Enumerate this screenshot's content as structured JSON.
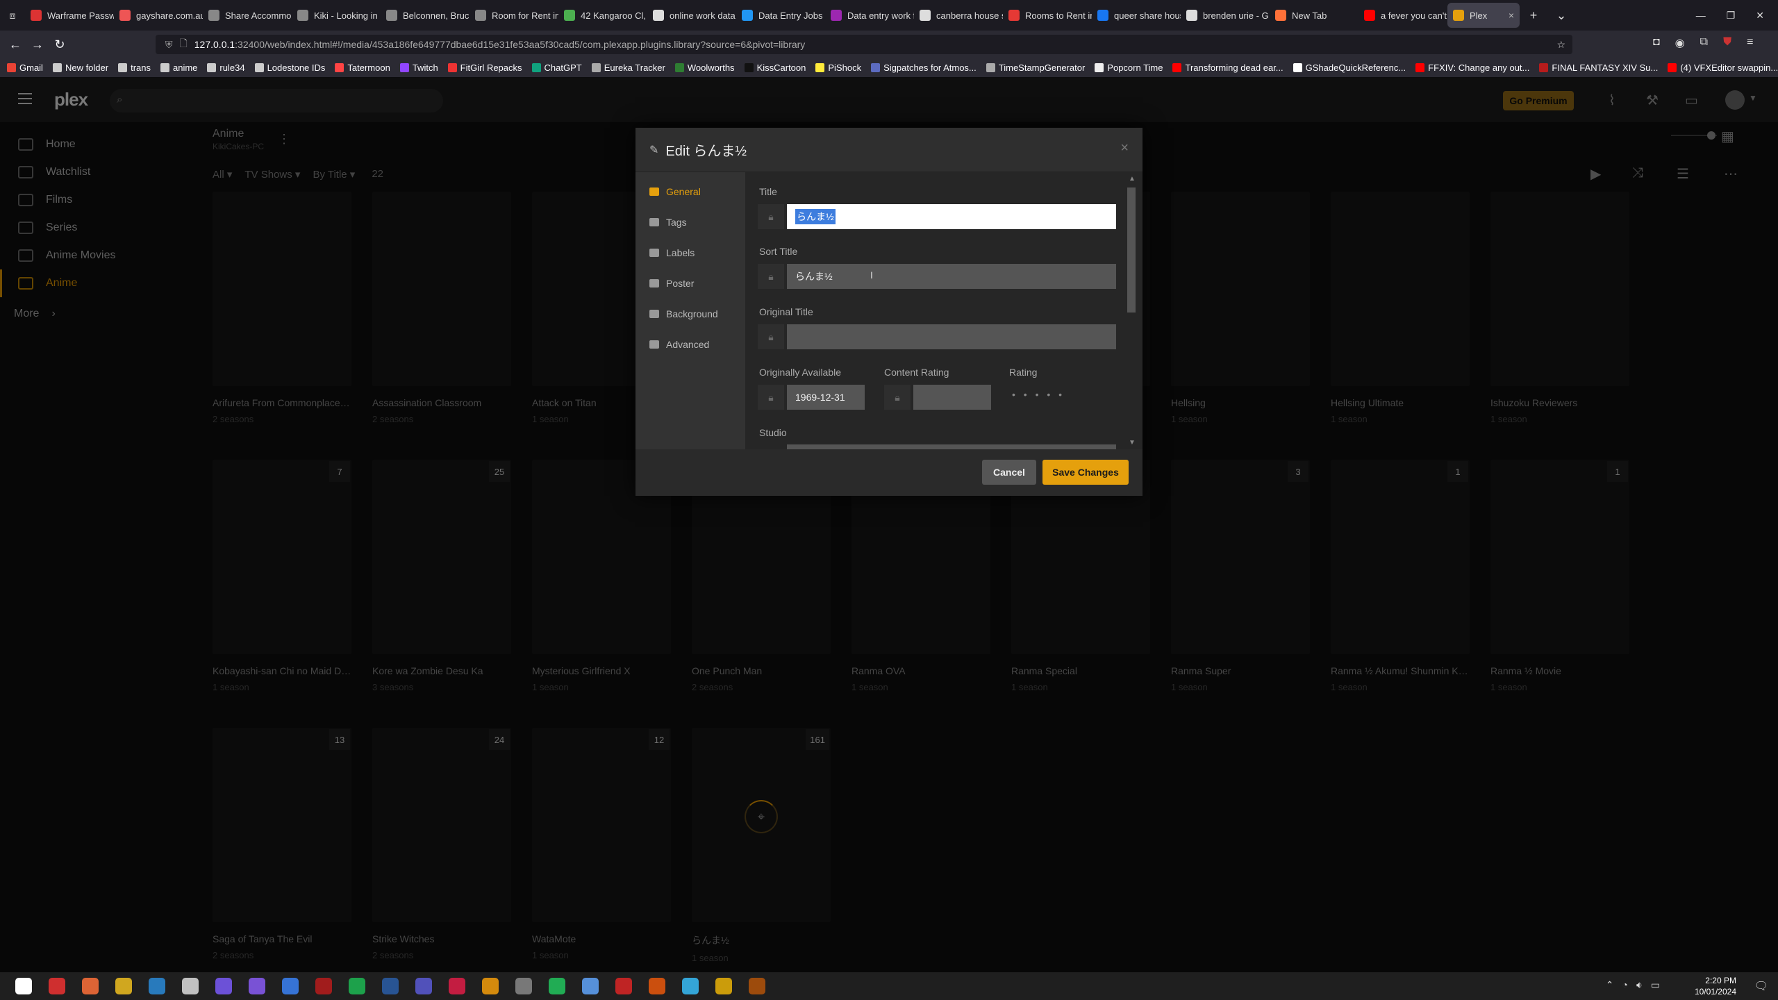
{
  "browser": {
    "tabs": [
      {
        "label": "Warframe Passw",
        "color": "#d33"
      },
      {
        "label": "gayshare.com.au",
        "color": "#e55"
      },
      {
        "label": "Share Accommo",
        "color": "#888"
      },
      {
        "label": "Kiki - Looking in",
        "color": "#888"
      },
      {
        "label": "Belconnen, Bruc",
        "color": "#888"
      },
      {
        "label": "Room for Rent in",
        "color": "#888"
      },
      {
        "label": "42 Kangaroo Cl,",
        "color": "#4caf50"
      },
      {
        "label": "online work data",
        "color": "#ddd"
      },
      {
        "label": "Data Entry Jobs f",
        "color": "#2196f3"
      },
      {
        "label": "Data entry work f",
        "color": "#9c27b0"
      },
      {
        "label": "canberra house s",
        "color": "#ddd"
      },
      {
        "label": "Rooms to Rent in",
        "color": "#e53935"
      },
      {
        "label": "queer share hous",
        "color": "#1877f2"
      },
      {
        "label": "brenden urie - G",
        "color": "#ddd"
      },
      {
        "label": "New Tab",
        "color": "#ff7139"
      },
      {
        "label": "a fever you can't",
        "color": "#f00"
      },
      {
        "label": "Plex",
        "color": "#e5a00d"
      }
    ],
    "url_host": "127.0.0.1",
    "url_rest": ":32400/web/index.html#!/media/453a186fe649777dbae6d15e31fe53aa5f30cad5/com.plexapp.plugins.library?source=6&pivot=library",
    "bookmarks": [
      {
        "label": "Gmail",
        "color": "#ea4335"
      },
      {
        "label": "New folder",
        "color": "#ccc"
      },
      {
        "label": "trans",
        "color": "#ccc"
      },
      {
        "label": "anime",
        "color": "#ccc"
      },
      {
        "label": "rule34",
        "color": "#ccc"
      },
      {
        "label": "Lodestone IDs",
        "color": "#ccc"
      },
      {
        "label": "Tatermoon",
        "color": "#f44"
      },
      {
        "label": "Twitch",
        "color": "#9146ff"
      },
      {
        "label": "FitGirl Repacks",
        "color": "#e33"
      },
      {
        "label": "ChatGPT",
        "color": "#10a37f"
      },
      {
        "label": "Eureka Tracker",
        "color": "#aaa"
      },
      {
        "label": "Woolworths",
        "color": "#2e7d32"
      },
      {
        "label": "KissCartoon",
        "color": "#111"
      },
      {
        "label": "PiShock",
        "color": "#ffeb3b"
      },
      {
        "label": "Sigpatches for Atmos...",
        "color": "#5c6bc0"
      },
      {
        "label": "TimeStampGenerator",
        "color": "#aaa"
      },
      {
        "label": "Popcorn Time",
        "color": "#eee"
      },
      {
        "label": "Transforming dead ear...",
        "color": "#f00"
      },
      {
        "label": "GShadeQuickReferenc...",
        "color": "#fff"
      },
      {
        "label": "FFXIV: Change any out...",
        "color": "#f00"
      },
      {
        "label": "FINAL FANTASY XIV Su...",
        "color": "#b71c1c"
      },
      {
        "label": "(4) VFXEditor swappin...",
        "color": "#f00"
      }
    ]
  },
  "plex": {
    "logo": "plex",
    "premium_label": "Go Premium",
    "sidebar": [
      {
        "label": "Home"
      },
      {
        "label": "Watchlist"
      },
      {
        "label": "Films"
      },
      {
        "label": "Series"
      },
      {
        "label": "Anime Movies"
      },
      {
        "label": "Anime"
      }
    ],
    "more_label": "More",
    "library": {
      "name": "Anime",
      "server": "KikiCakes-PC",
      "filter_all": "All",
      "filter_type": "TV Shows",
      "sort": "By Title",
      "count": "22"
    },
    "items": [
      {
        "title": "Arifureta From Commonplace t...",
        "sub": "2 seasons",
        "badge": ""
      },
      {
        "title": "Assassination Classroom",
        "sub": "2 seasons",
        "badge": ""
      },
      {
        "title": "Attack on Titan",
        "sub": "1 season",
        "badge": ""
      },
      {
        "title": "",
        "sub": "",
        "badge": ""
      },
      {
        "title": "",
        "sub": "",
        "badge": ""
      },
      {
        "title": "",
        "sub": "",
        "badge": ""
      },
      {
        "title": "Hellsing",
        "sub": "1 season",
        "badge": ""
      },
      {
        "title": "Hellsing Ultimate",
        "sub": "1 season",
        "badge": ""
      },
      {
        "title": "Ishuzoku Reviewers",
        "sub": "1 season",
        "badge": ""
      },
      {
        "title": "Kobayashi-san Chi no Maid Dr...",
        "sub": "1 season",
        "badge": "7"
      },
      {
        "title": "Kore wa Zombie Desu Ka",
        "sub": "3 seasons",
        "badge": "25"
      },
      {
        "title": "Mysterious Girlfriend X",
        "sub": "1 season",
        "badge": ""
      },
      {
        "title": "One Punch Man",
        "sub": "2 seasons",
        "badge": ""
      },
      {
        "title": "Ranma OVA",
        "sub": "1 season",
        "badge": ""
      },
      {
        "title": "Ranma Special",
        "sub": "1 season",
        "badge": ""
      },
      {
        "title": "Ranma Super",
        "sub": "1 season",
        "badge": "3"
      },
      {
        "title": "Ranma ½ Akumu! Shunmin Kou...",
        "sub": "1 season",
        "badge": "1"
      },
      {
        "title": "Ranma ½ Movie",
        "sub": "1 season",
        "badge": "1"
      },
      {
        "title": "Saga of Tanya The Evil",
        "sub": "2 seasons",
        "badge": "13"
      },
      {
        "title": "Strike Witches",
        "sub": "2 seasons",
        "badge": "24"
      },
      {
        "title": "WataMote",
        "sub": "1 season",
        "badge": "12"
      },
      {
        "title": "らんま½",
        "sub": "1 season",
        "badge": "161"
      }
    ]
  },
  "modal": {
    "title": "Edit らんま½",
    "nav": [
      {
        "label": "General"
      },
      {
        "label": "Tags"
      },
      {
        "label": "Labels"
      },
      {
        "label": "Poster"
      },
      {
        "label": "Background"
      },
      {
        "label": "Advanced"
      }
    ],
    "fields": {
      "title_label": "Title",
      "title_value": "らんま½",
      "sort_label": "Sort Title",
      "sort_value": "らんま½",
      "original_label": "Original Title",
      "original_value": "",
      "available_label": "Originally Available",
      "available_value": "1969-12-31",
      "rating_content_label": "Content Rating",
      "rating_content_value": "",
      "rating_label": "Rating",
      "rating_stars": "• • • • •",
      "studio_label": "Studio"
    },
    "cancel_label": "Cancel",
    "save_label": "Save Changes",
    "accent": "#e5a00d"
  },
  "taskbar": {
    "time": "2:20 PM",
    "date": "10/01/2024"
  }
}
